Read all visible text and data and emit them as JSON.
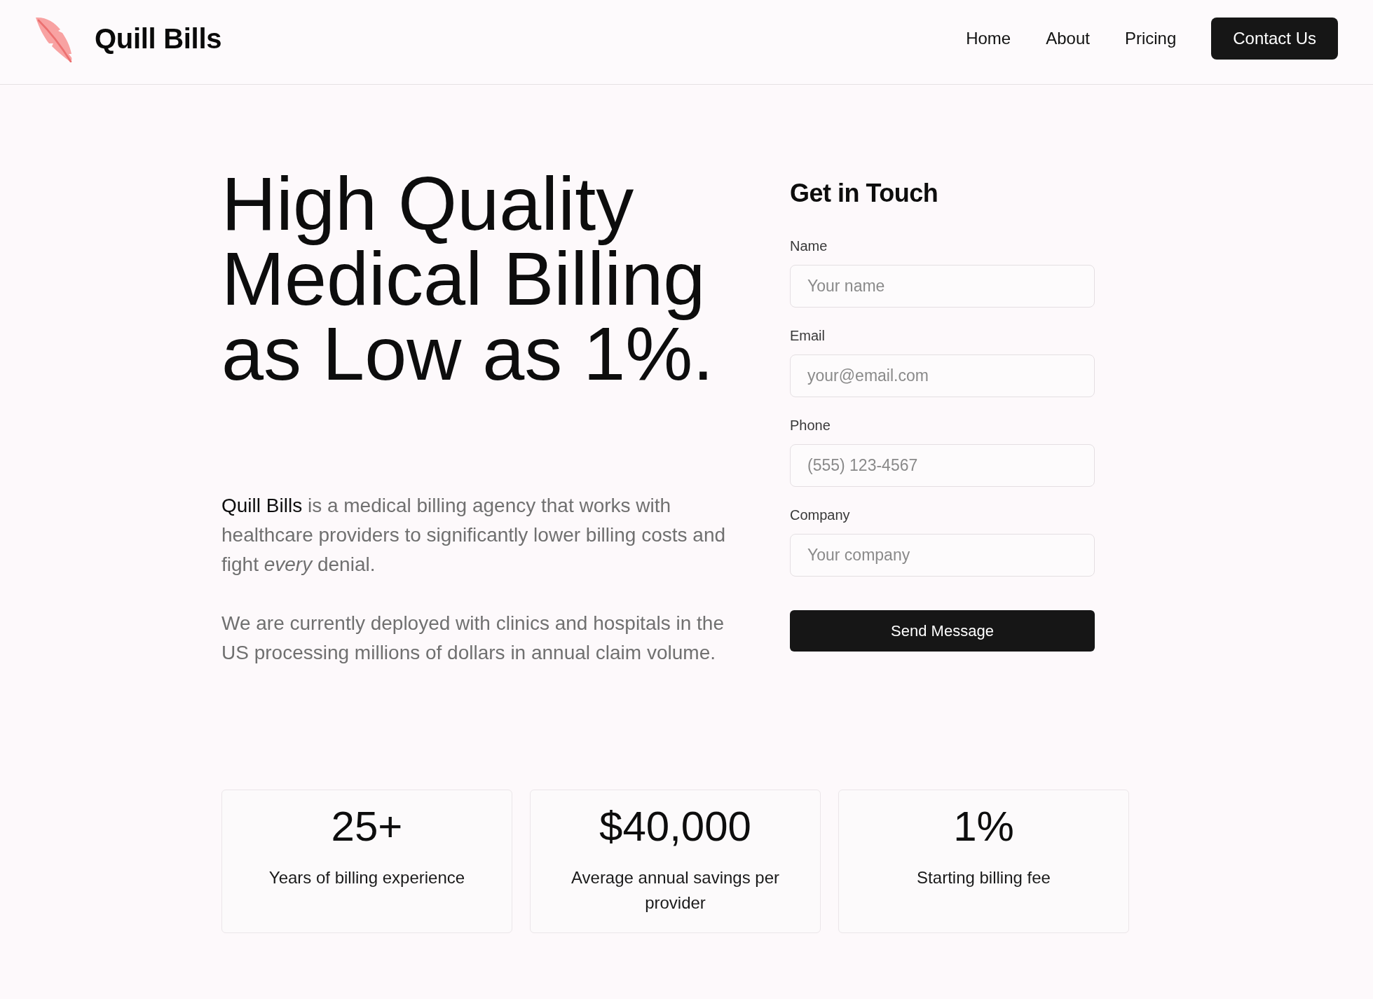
{
  "header": {
    "brand": "Quill Bills",
    "nav": [
      {
        "label": "Home"
      },
      {
        "label": "About"
      },
      {
        "label": "Pricing"
      }
    ],
    "cta": "Contact Us"
  },
  "hero": {
    "headline": "High Quality Medical Billing as Low as 1%.",
    "paragraphs": [
      {
        "brand": "Quill Bills",
        "text": "is a medical billing agency that works with healthcare providers to significantly lower billing costs and fight *every* denial."
      },
      {
        "text": "We are currently deployed with clinics and hospitals in the US processing millions of dollars in annual claim volume."
      }
    ]
  },
  "contact_form": {
    "title": "Get in Touch",
    "fields": [
      {
        "label": "Name",
        "placeholder": "Your name"
      },
      {
        "label": "Email",
        "placeholder": "your@email.com"
      },
      {
        "label": "Phone",
        "placeholder": "(555) 123-4567"
      },
      {
        "label": "Company",
        "placeholder": "Your company"
      }
    ],
    "submit": "Send Message"
  },
  "stats": [
    {
      "value": "25+",
      "label": "Years of billing experience"
    },
    {
      "value": "$40,000",
      "label": "Average annual savings per provider"
    },
    {
      "value": "1%",
      "label": "Starting billing fee"
    }
  ]
}
